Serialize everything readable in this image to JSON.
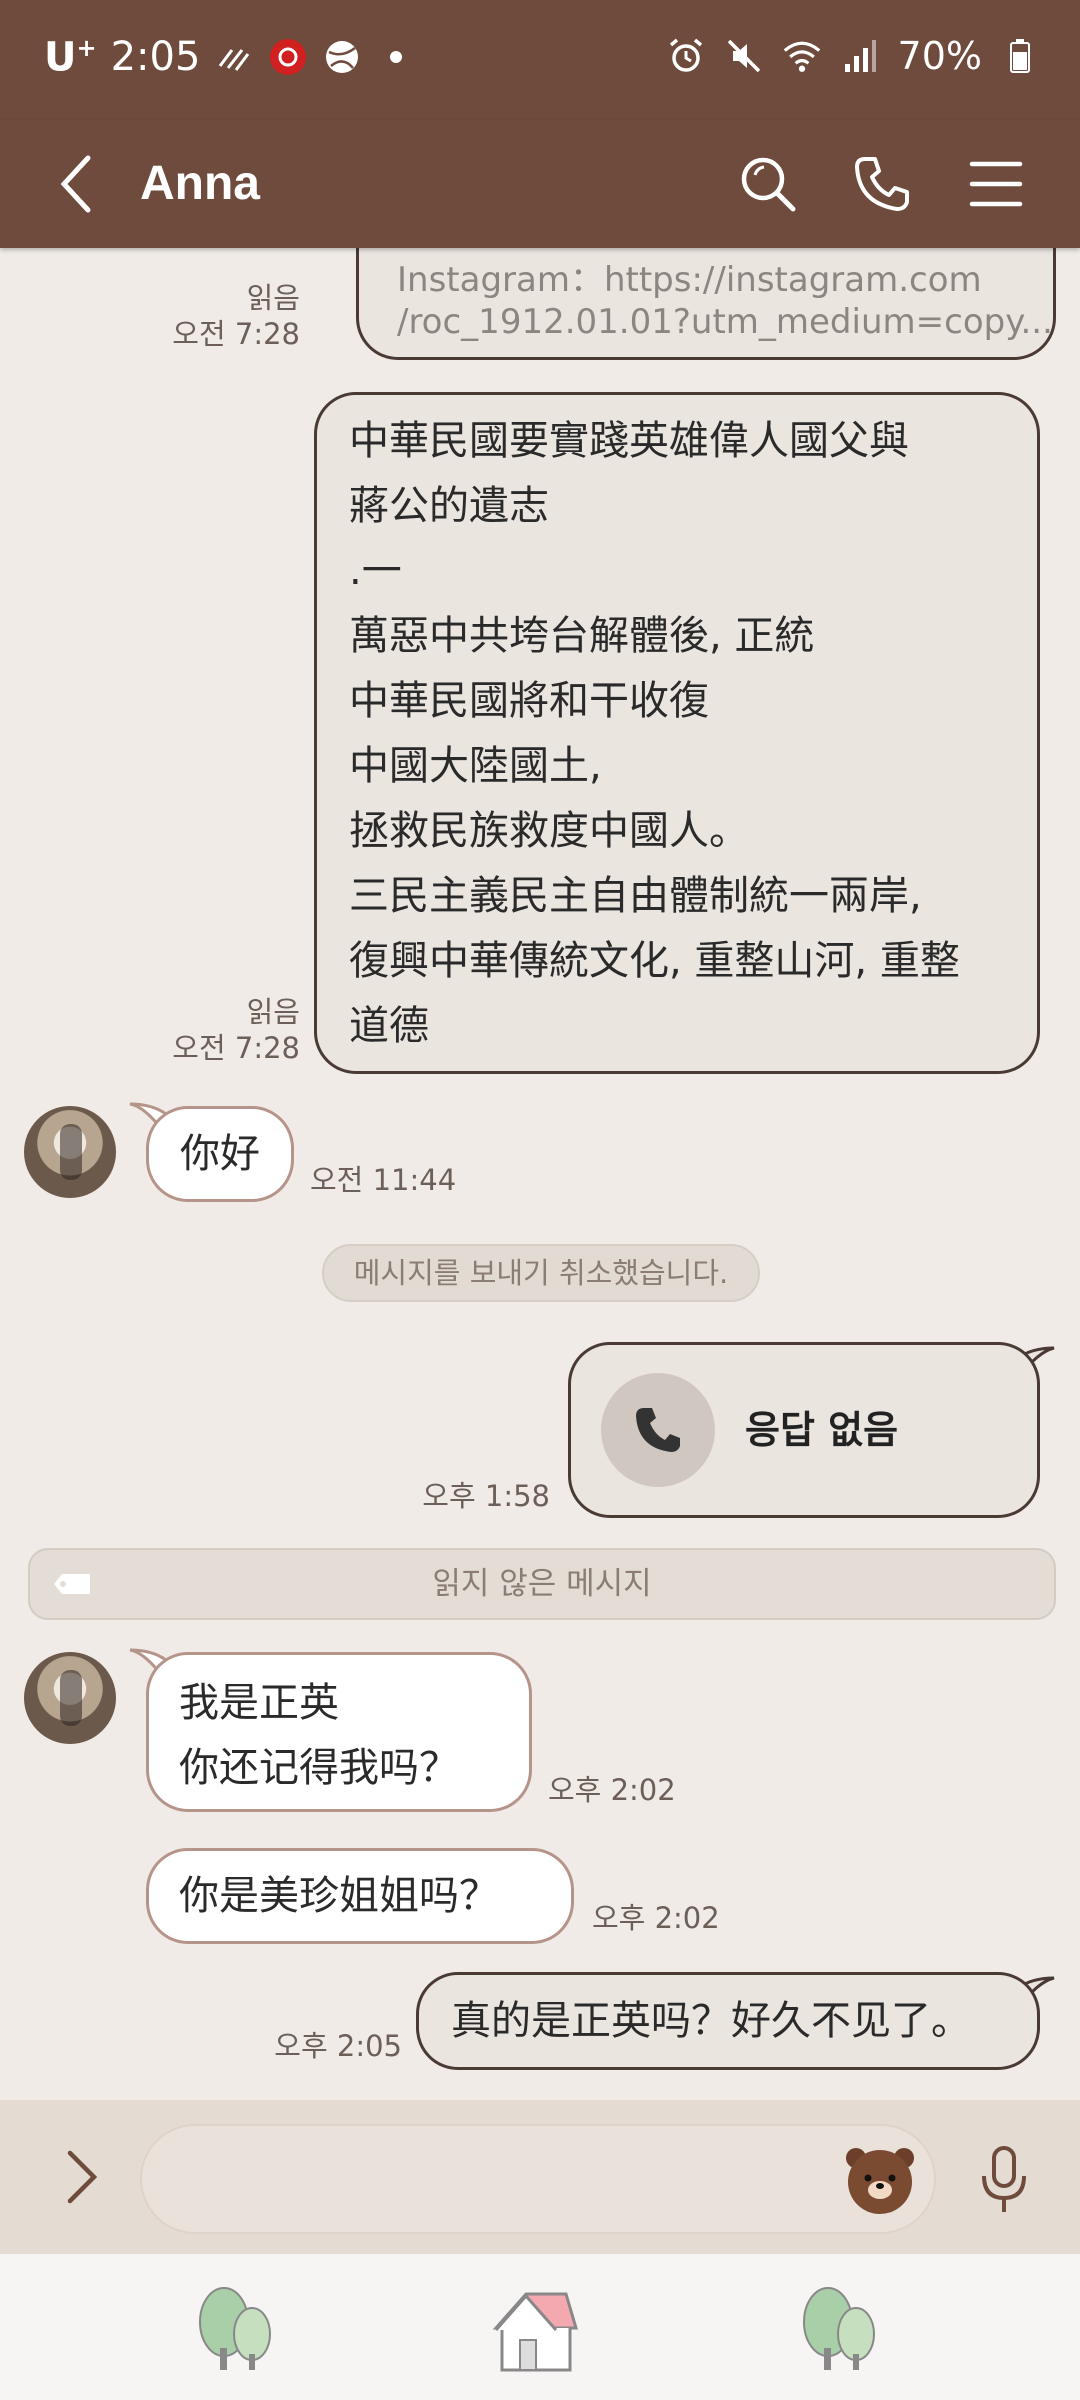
{
  "status_bar": {
    "carrier": "U",
    "carrier_sup": "+",
    "time": "2:05",
    "battery": "70%"
  },
  "header": {
    "title": "Anna",
    "icons": [
      "back-icon",
      "search-icon",
      "phone-icon",
      "menu-icon"
    ]
  },
  "messages": {
    "m1": {
      "line1": "Instagram：https://instagram.com",
      "line2": "/roc_1912.01.01?utm_medium=copy...",
      "read": "읽음",
      "time": "오전 7:28"
    },
    "m2": {
      "lines": [
        "中華民國要實踐英雄偉人國父與",
        "蔣公的遺志",
        ".一",
        "萬惡中共垮台解體後, 正統",
        "中華民國將和干收復",
        "中國大陸國土,",
        "拯救民族救度中國人。",
        "三民主義民主自由體制統一兩岸,",
        "復興中華傳統文化, 重整山河, 重整",
        "道德"
      ],
      "read": "읽음",
      "time": "오전 7:28"
    },
    "m3": {
      "text": "你好",
      "time": "오전 11:44"
    },
    "system": {
      "text": "메시지를 보내기 취소했습니다."
    },
    "call": {
      "text": "응답 없음",
      "time": "오후 1:58"
    },
    "unread": {
      "text": "읽지 않은 메시지"
    },
    "m4": {
      "line1": "我是正英",
      "line2": "你还记得我吗？",
      "time": "오후 2:02"
    },
    "m5": {
      "text": "你是美珍姐姐吗？",
      "time": "오후 2:02"
    },
    "m6": {
      "text": "真的是正英吗？好久不见了。",
      "time": "오후 2:05"
    }
  },
  "input": {
    "value": "",
    "placeholder": ""
  },
  "colors": {
    "header_bg": "#6e4b3c",
    "chat_bg": "#f0ebe6",
    "outgoing_bubble": "#ebe5e0",
    "incoming_bubble": "#ffffff",
    "input_bar_bg": "#e4dbd3"
  }
}
